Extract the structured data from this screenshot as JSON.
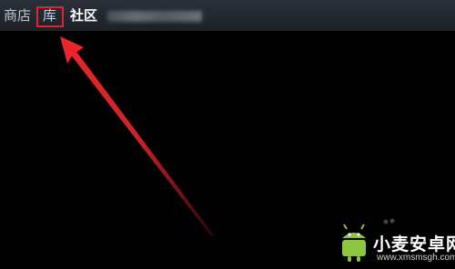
{
  "nav": {
    "store_label": "商店",
    "library_label": "库",
    "community_label": "社区"
  },
  "annotation": {
    "highlight_color": "#e0262c",
    "arrow_color": "#e0262c"
  },
  "watermark": {
    "title": "小麦安卓网",
    "url": "www.xmsmsgh.com"
  }
}
